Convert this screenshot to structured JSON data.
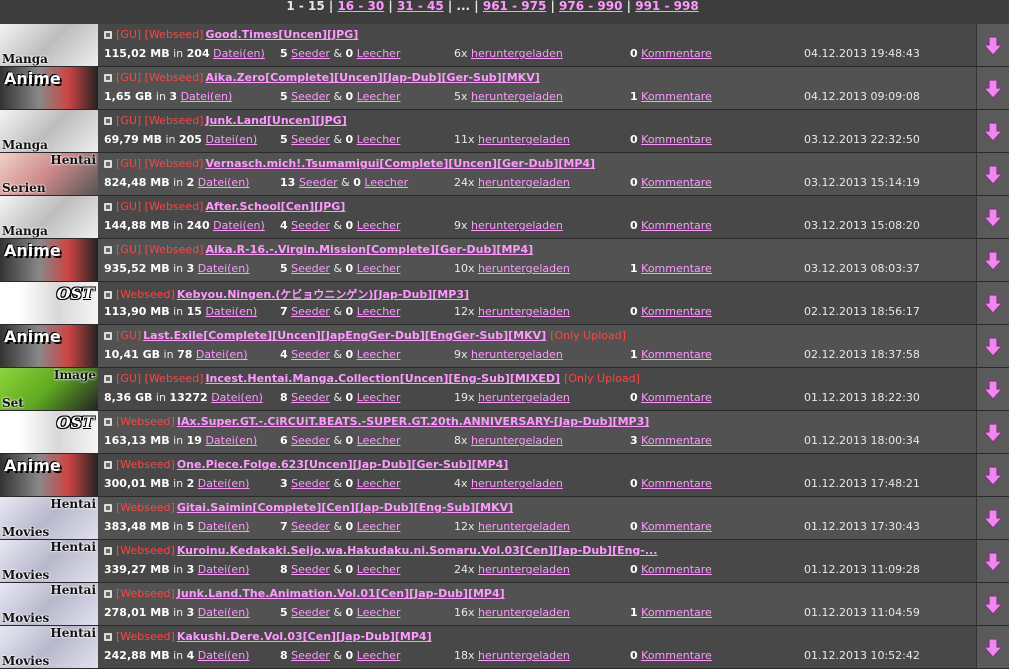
{
  "pager": {
    "current": "1 - 15",
    "pages": [
      "16 - 30",
      "31 - 45"
    ],
    "ellipsis": "...",
    "pages_end": [
      "961 - 975",
      "976 - 990",
      "991 - 998"
    ]
  },
  "labels": {
    "in": "in",
    "files": "Datei(en)",
    "seeder": "Seeder",
    "amp": "&",
    "leecher": "Leecher",
    "downloaded": "heruntergeladen",
    "comments": "Kommentare"
  },
  "rows": [
    {
      "cat": "manga",
      "cat_top": "",
      "cat_bottom": "Manga",
      "tags": "[GU] [Webseed]",
      "title": "Good.Times[Uncen][JPG]",
      "note": "",
      "size": "115,02 MB",
      "files": "204",
      "seeders": "5",
      "leechers": "0",
      "downloads": "6x",
      "comments": "0",
      "date": "04.12.2013 19:48:43"
    },
    {
      "cat": "anime",
      "cat_top": "Anime",
      "cat_bottom": "",
      "tags": "[GU] [Webseed]",
      "title": "Aika.Zero[Complete][Uncen][Jap-Dub][Ger-Sub][MKV]",
      "note": "",
      "size": "1,65 GB",
      "files": "3",
      "seeders": "5",
      "leechers": "0",
      "downloads": "5x",
      "comments": "1",
      "date": "04.12.2013 09:09:08"
    },
    {
      "cat": "manga",
      "cat_top": "",
      "cat_bottom": "Manga",
      "tags": "[GU] [Webseed]",
      "title": "Junk.Land[Uncen][JPG]",
      "note": "",
      "size": "69,79 MB",
      "files": "205",
      "seeders": "5",
      "leechers": "0",
      "downloads": "11x",
      "comments": "0",
      "date": "03.12.2013 22:32:50"
    },
    {
      "cat": "hentai",
      "cat_top": "Hentai",
      "cat_bottom": "Serien",
      "tags": "[GU] [Webseed]",
      "title": "Vernasch.mich!.Tsumamigui[Complete][Uncen][Ger-Dub][MP4]",
      "note": "",
      "size": "824,48 MB",
      "files": "2",
      "seeders": "13",
      "leechers": "0",
      "downloads": "24x",
      "comments": "0",
      "date": "03.12.2013 15:14:19"
    },
    {
      "cat": "manga",
      "cat_top": "",
      "cat_bottom": "Manga",
      "tags": "[GU] [Webseed]",
      "title": "After.School[Cen][JPG]",
      "note": "",
      "size": "144,88 MB",
      "files": "240",
      "seeders": "4",
      "leechers": "0",
      "downloads": "9x",
      "comments": "0",
      "date": "03.12.2013 15:08:20"
    },
    {
      "cat": "anime",
      "cat_top": "Anime",
      "cat_bottom": "",
      "tags": "[GU] [Webseed]",
      "title": "Aika.R-16.-.Virgin.Mission[Complete][Ger-Dub][MP4]",
      "note": "",
      "size": "935,52 MB",
      "files": "3",
      "seeders": "5",
      "leechers": "0",
      "downloads": "10x",
      "comments": "1",
      "date": "03.12.2013 08:03:37"
    },
    {
      "cat": "ost",
      "cat_top": "OST",
      "cat_bottom": "",
      "tags": "[Webseed]",
      "title": "Kebyou.Ningen.(ケビョウニンゲン)[Jap-Dub][MP3]",
      "note": "",
      "size": "113,90 MB",
      "files": "15",
      "seeders": "7",
      "leechers": "0",
      "downloads": "12x",
      "comments": "0",
      "date": "02.12.2013 18:56:17"
    },
    {
      "cat": "anime",
      "cat_top": "Anime",
      "cat_bottom": "",
      "tags": "[GU]",
      "title": "Last.Exile[Complete][Uncen][JapEngGer-Dub][EngGer-Sub][MKV]",
      "note": "[Only Upload]",
      "size": "10,41 GB",
      "files": "78",
      "seeders": "4",
      "leechers": "0",
      "downloads": "9x",
      "comments": "1",
      "date": "02.12.2013 18:37:58"
    },
    {
      "cat": "set",
      "cat_top": "Image",
      "cat_bottom": "Set",
      "tags": "[GU] [Webseed]",
      "title": "Incest.Hentai.Manga.Collection[Uncen][Eng-Sub][MIXED]",
      "note": "[Only Upload]",
      "size": "8,36 GB",
      "files": "13272",
      "seeders": "8",
      "leechers": "0",
      "downloads": "19x",
      "comments": "0",
      "date": "01.12.2013 18:22:30"
    },
    {
      "cat": "ost",
      "cat_top": "OST",
      "cat_bottom": "",
      "tags": "[Webseed]",
      "title": "IAx.Super.GT.-.CiRCUiT.BEATS.-SUPER.GT.20th.ANNIVERSARY-[Jap-Dub][MP3]",
      "note": "",
      "size": "163,13 MB",
      "files": "19",
      "seeders": "6",
      "leechers": "0",
      "downloads": "8x",
      "comments": "3",
      "date": "01.12.2013 18:00:34"
    },
    {
      "cat": "anime",
      "cat_top": "Anime",
      "cat_bottom": "",
      "tags": "[Webseed]",
      "title": "One.Piece.Folge.623[Uncen][Jap-Dub][Ger-Sub][MP4]",
      "note": "",
      "size": "300,01 MB",
      "files": "2",
      "seeders": "3",
      "leechers": "0",
      "downloads": "4x",
      "comments": "0",
      "date": "01.12.2013 17:48:21"
    },
    {
      "cat": "movies",
      "cat_top": "Hentai",
      "cat_bottom": "Movies",
      "tags": "[Webseed]",
      "title": "Gitai.Saimin[Complete][Cen][Jap-Dub][Eng-Sub][MKV]",
      "note": "",
      "size": "383,48 MB",
      "files": "5",
      "seeders": "7",
      "leechers": "0",
      "downloads": "12x",
      "comments": "0",
      "date": "01.12.2013 17:30:43"
    },
    {
      "cat": "movies",
      "cat_top": "Hentai",
      "cat_bottom": "Movies",
      "tags": "[Webseed]",
      "title": "Kuroinu.Kedakaki.Seijo.wa.Hakudaku.ni.Somaru.Vol.03[Cen][Jap-Dub][Eng-...",
      "note": "",
      "size": "339,27 MB",
      "files": "3",
      "seeders": "8",
      "leechers": "0",
      "downloads": "24x",
      "comments": "0",
      "date": "01.12.2013 11:09:28"
    },
    {
      "cat": "movies",
      "cat_top": "Hentai",
      "cat_bottom": "Movies",
      "tags": "[Webseed]",
      "title": "Junk.Land.The.Animation.Vol.01[Cen][Jap-Dub][MP4]",
      "note": "",
      "size": "278,01 MB",
      "files": "3",
      "seeders": "5",
      "leechers": "0",
      "downloads": "16x",
      "comments": "1",
      "date": "01.12.2013 11:04:59"
    },
    {
      "cat": "movies",
      "cat_top": "Hentai",
      "cat_bottom": "Movies",
      "tags": "[Webseed]",
      "title": "Kakushi.Dere.Vol.03[Cen][Jap-Dub][MP4]",
      "note": "",
      "size": "242,88 MB",
      "files": "4",
      "seeders": "8",
      "leechers": "0",
      "downloads": "18x",
      "comments": "0",
      "date": "01.12.2013 10:52:42"
    }
  ],
  "colors": {
    "link": "#ff99ff",
    "tag": "#ff4444",
    "row_bg": "#484848",
    "row_alt_bg": "#525252",
    "download_arrow": "#ee88ee"
  },
  "icons": {
    "row_icon": "torrent-small-icon",
    "download": "download-arrow-icon"
  }
}
